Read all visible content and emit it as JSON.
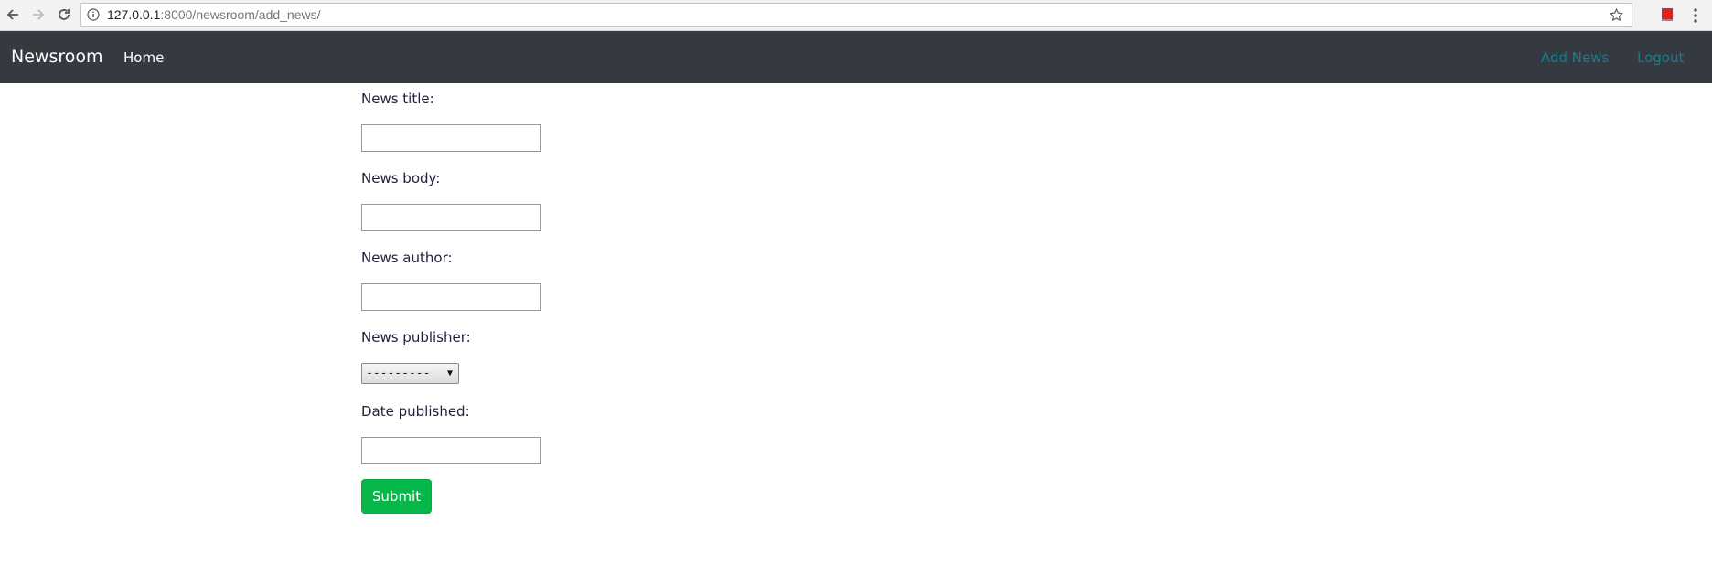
{
  "browser": {
    "url_host": "127.0.0.1",
    "url_rest": ":8000/newsroom/add_news/",
    "back_icon": "arrow-left-icon",
    "forward_icon": "arrow-right-icon",
    "reload_icon": "reload-icon",
    "info_icon": "info-icon",
    "star_icon": "star-icon",
    "menu_icon": "vertical-dots-icon"
  },
  "navbar": {
    "brand": "Newsroom",
    "home": "Home",
    "add_news": "Add News",
    "logout": "Logout",
    "bg_color": "#343a40",
    "link_color": "#1c7c8c"
  },
  "form": {
    "title_label": "News title:",
    "title_value": "",
    "body_label": "News body:",
    "body_value": "",
    "author_label": "News author:",
    "author_value": "",
    "publisher_label": "News publisher:",
    "publisher_selected": "---------",
    "date_label": "Date published:",
    "date_value": "",
    "submit_label": "Submit",
    "submit_color": "#06b749"
  }
}
